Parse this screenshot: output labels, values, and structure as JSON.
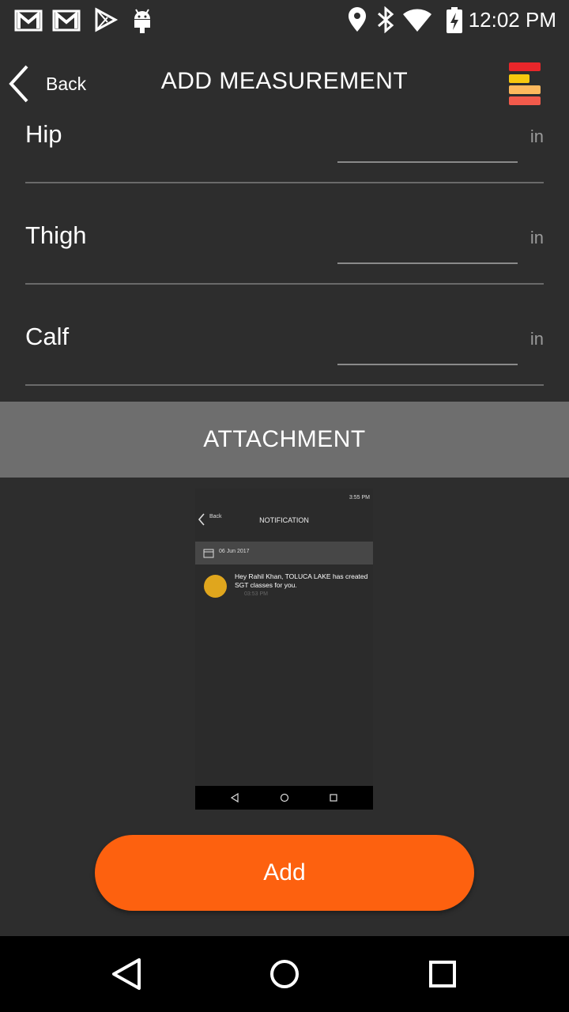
{
  "status_bar": {
    "time": "12:02 PM",
    "left_icons": [
      "gmail-icon",
      "gmail-icon",
      "play-store-icon",
      "android-icon"
    ],
    "right_icons": [
      "location-icon",
      "bluetooth-icon",
      "wifi-icon",
      "battery-charging-icon"
    ]
  },
  "header": {
    "back_label": "Back",
    "title": "ADD MEASUREMENT",
    "menu_icon": "stacked-menu-icon",
    "colors": {
      "bar_red": "#e8262a",
      "bar_yellow": "#f7c80e",
      "bar_light_orange": "#fdb85d",
      "bar_coral": "#f25a4b"
    }
  },
  "measurements": [
    {
      "label": "Hip",
      "value": "",
      "unit": "in"
    },
    {
      "label": "Thigh",
      "value": "",
      "unit": "in"
    },
    {
      "label": "Calf",
      "value": "",
      "unit": "in"
    }
  ],
  "attachment": {
    "label": "ATTACHMENT",
    "preview": {
      "status_time": "3:55 PM",
      "back_label": "Back",
      "title": "NOTIFICATION",
      "date": "06 Jun 2017",
      "message": "Hey Rahil Khan, TOLUCA LAKE  has created SGT classes for you.",
      "time": "03:53 PM"
    }
  },
  "add_button": {
    "label": "Add",
    "color": "#fd610f"
  },
  "nav_bar": {
    "icons": [
      "back-triangle-icon",
      "home-circle-icon",
      "recents-square-icon"
    ]
  }
}
